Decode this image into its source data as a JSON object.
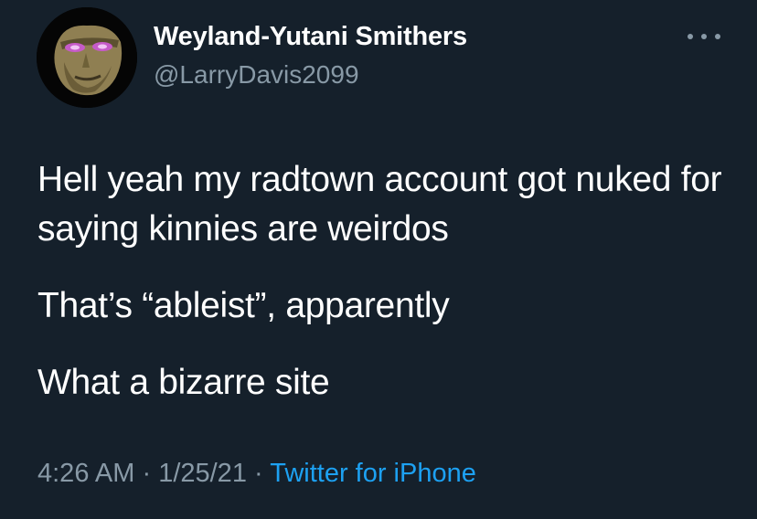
{
  "user": {
    "display_name": "Weyland-Yutani Smithers",
    "handle": "@LarryDavis2099"
  },
  "tweet": {
    "paragraphs": [
      "Hell yeah my radtown account got nuked for saying kinnies are weirdos",
      "That’s “ableist”, apparently",
      "What a bizarre site"
    ],
    "time": "4:26 AM",
    "separator": " · ",
    "date": "1/25/21",
    "source": "Twitter for iPhone"
  },
  "icons": {
    "more": "more-horizontal-icon",
    "avatar": "avatar-image"
  },
  "colors": {
    "background": "#15202b",
    "secondary_text": "#8899a6",
    "link": "#1da1f2",
    "primary_text": "#ffffff"
  }
}
